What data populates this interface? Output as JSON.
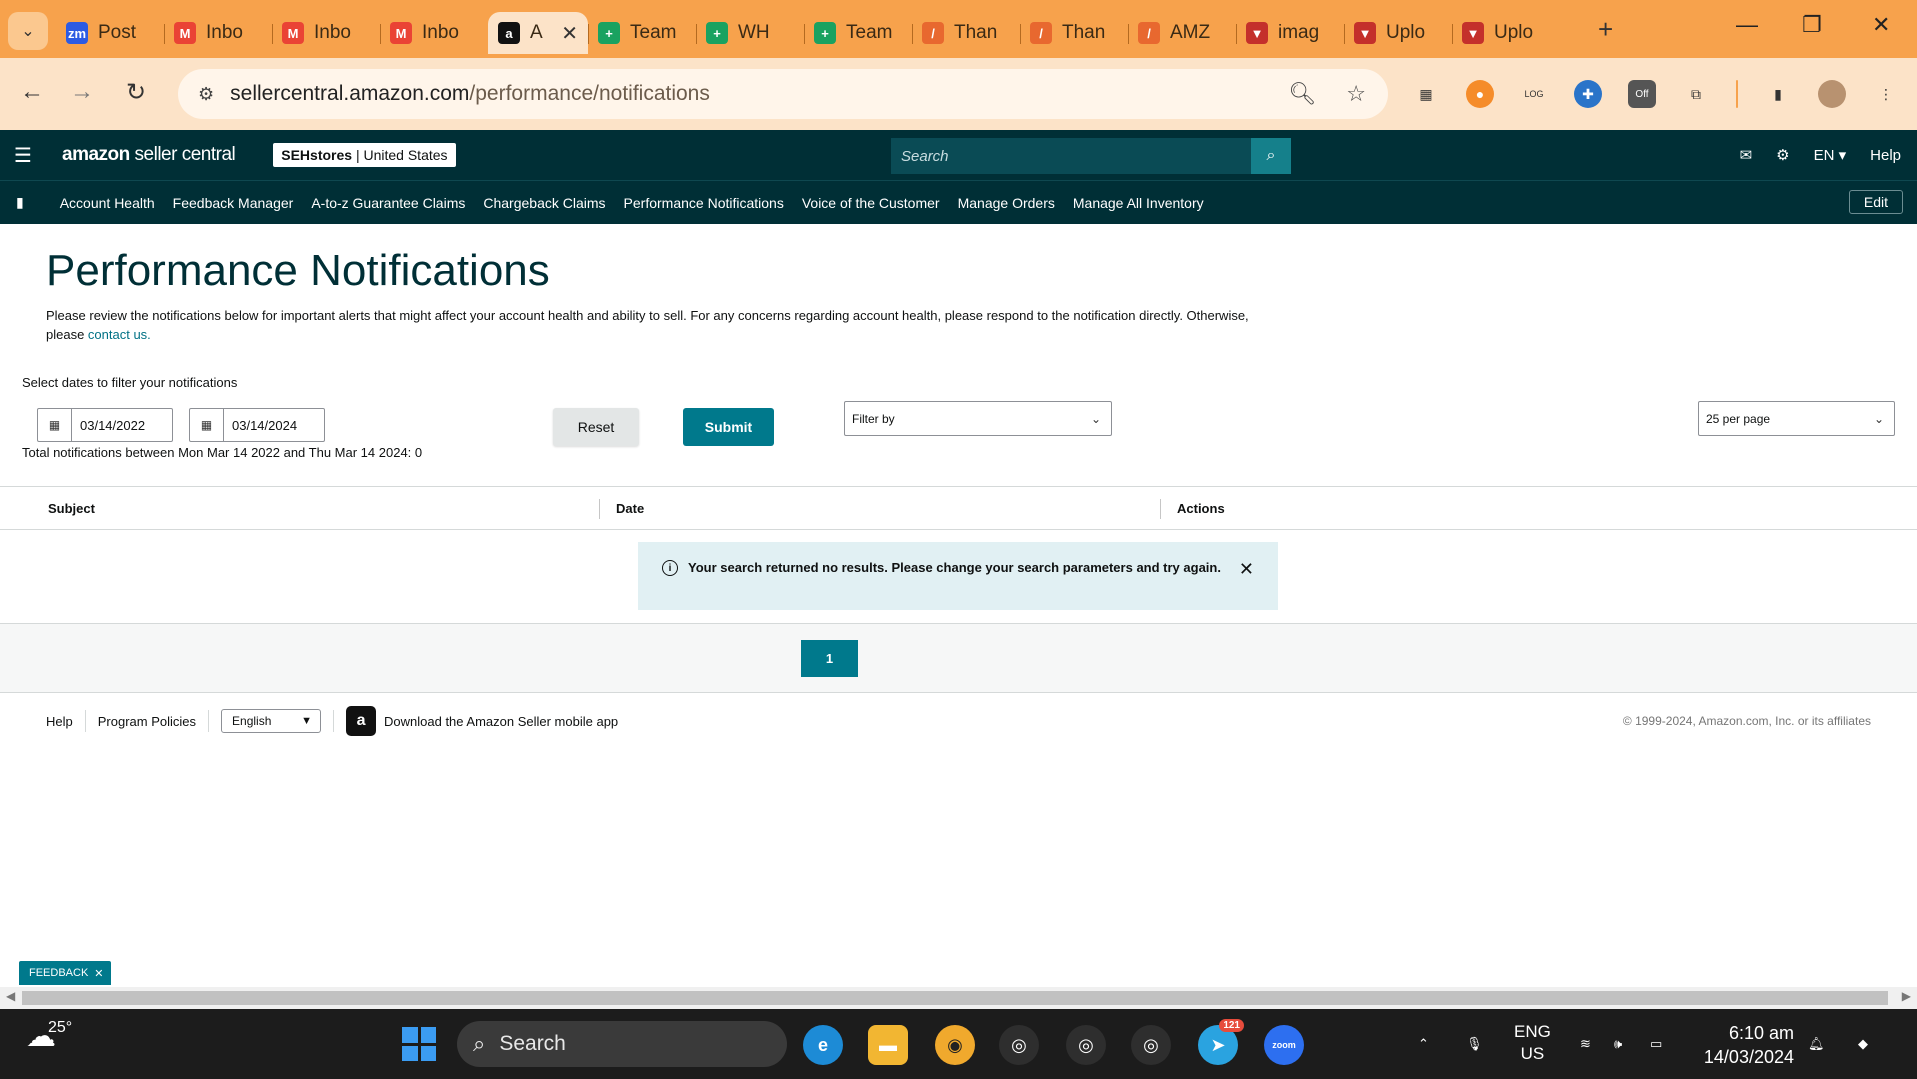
{
  "browser": {
    "tabs": [
      {
        "title": "Post",
        "icon": "zoom-icon",
        "color": "#2d5be3",
        "glyph": "zm"
      },
      {
        "title": "Inbo",
        "icon": "gmail-icon",
        "color": "#ea4335",
        "glyph": "M"
      },
      {
        "title": "Inbo",
        "icon": "gmail-icon",
        "color": "#ea4335",
        "glyph": "M"
      },
      {
        "title": "Inbo",
        "icon": "gmail-icon",
        "color": "#ea4335",
        "glyph": "M"
      },
      {
        "title": "A",
        "icon": "amazon-icon",
        "color": "#111111",
        "glyph": "a",
        "active": true
      },
      {
        "title": "Team",
        "icon": "sheets-icon",
        "color": "#1aa260",
        "glyph": "+"
      },
      {
        "title": "WH",
        "icon": "sheets-icon",
        "color": "#1aa260",
        "glyph": "+"
      },
      {
        "title": "Team",
        "icon": "sheets-icon",
        "color": "#1aa260",
        "glyph": "+"
      },
      {
        "title": "Than",
        "icon": "pen-icon",
        "color": "#e8682f",
        "glyph": "/"
      },
      {
        "title": "Than",
        "icon": "pen-icon",
        "color": "#e8682f",
        "glyph": "/"
      },
      {
        "title": "AMZ",
        "icon": "pen-icon",
        "color": "#e8682f",
        "glyph": "/"
      },
      {
        "title": "imag",
        "icon": "upload-icon",
        "color": "#c4302b",
        "glyph": "▼"
      },
      {
        "title": "Uplo",
        "icon": "upload-icon",
        "color": "#c4302b",
        "glyph": "▼"
      },
      {
        "title": "Uplo",
        "icon": "upload-icon",
        "color": "#c4302b",
        "glyph": "▼"
      }
    ],
    "url_host": "sellercentral.amazon.com",
    "url_path": "/performance/notifications"
  },
  "header": {
    "logo_main": "amazon",
    "logo_sub": " seller central",
    "store_name": "SEHstores",
    "store_region": " | United States",
    "search_placeholder": "Search",
    "language": "EN ▾",
    "help": "Help"
  },
  "nav": {
    "links": [
      "Account Health",
      "Feedback Manager",
      "A-to-z Guarantee Claims",
      "Chargeback Claims",
      "Performance Notifications",
      "Voice of the Customer",
      "Manage Orders",
      "Manage All Inventory"
    ],
    "edit": "Edit"
  },
  "main": {
    "title": "Performance Notifications",
    "intro": "Please review the notifications below for important alerts that might affect your account health and ability to sell. For any concerns regarding account health, please respond to the notification directly. Otherwise, please ",
    "contact_link": "contact us.",
    "filter_label": "Select dates to filter your notifications",
    "start_date": "03/14/2022",
    "end_date": "03/14/2024",
    "reset": "Reset",
    "submit": "Submit",
    "filter_by": "Filter by",
    "per_page": "25 per page",
    "total": "Total notifications between Mon Mar 14 2022 and Thu Mar 14 2024: 0",
    "columns": {
      "subject": "Subject",
      "date": "Date",
      "actions": "Actions"
    },
    "alert": "Your search returned no results. Please change your search parameters and try again.",
    "page": "1"
  },
  "footer": {
    "help": "Help",
    "policies": "Program Policies",
    "language": "English",
    "app": "Download the Amazon Seller mobile app",
    "copyright": "© 1999-2024, Amazon.com, Inc. or its affiliates"
  },
  "feedback": "FEEDBACK",
  "taskbar": {
    "temp": "25°",
    "search": "Search",
    "lang1": "ENG",
    "lang2": "US",
    "time": "6:10 am",
    "date": "14/03/2024",
    "badge_telegram": "121"
  },
  "colors": {
    "header_bg": "#002f36",
    "accent": "#00798c",
    "browser": "#f7a24c"
  }
}
